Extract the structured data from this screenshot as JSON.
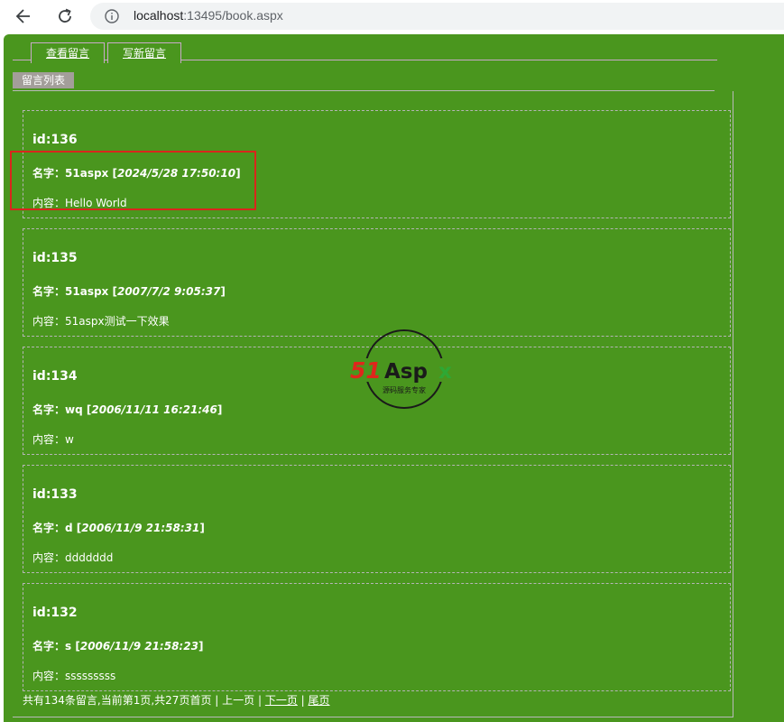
{
  "browser": {
    "url_host": "localhost",
    "url_rest": ":13495/book.aspx"
  },
  "tabs": [
    {
      "label": "查看留言"
    },
    {
      "label": "写新留言"
    }
  ],
  "list_title": "留言列表",
  "name_label": "名字：",
  "content_label": "内容：",
  "entries": [
    {
      "id": "id:136",
      "name": "51aspx",
      "time": "2024/5/28 17:50:10",
      "content": "Hello World"
    },
    {
      "id": "id:135",
      "name": "51aspx",
      "time": "2007/7/2 9:05:37",
      "content": "51aspx测试一下效果"
    },
    {
      "id": "id:134",
      "name": "wq",
      "time": "2006/11/11 16:21:46",
      "content": "w"
    },
    {
      "id": "id:133",
      "name": "d",
      "time": "2006/11/9 21:58:31",
      "content": "ddddddd"
    },
    {
      "id": "id:132",
      "name": "s",
      "time": "2006/11/9 21:58:23",
      "content": "sssssssss"
    }
  ],
  "pager": {
    "summary": "共有134条留言,当前第1页,共27页",
    "first": "首页",
    "prev": "上一页",
    "next": "下一页",
    "last": "尾页",
    "sep": " | "
  },
  "watermark": {
    "brand": "51Aspx",
    "tagline": "源码服务专家"
  },
  "colors": {
    "page_bg": "#4a961e",
    "highlight": "#d9261c",
    "watermark_red": "#e0261c",
    "watermark_green": "#2ea834"
  }
}
